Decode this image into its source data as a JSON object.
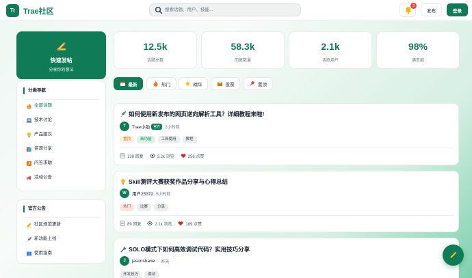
{
  "header": {
    "logo_badge": "Tr",
    "logo_text": "Trae社区",
    "search_placeholder": "搜索话题、用户、技能...",
    "notification_count": "3",
    "post_label": "发布",
    "login_label": "登录"
  },
  "sidebar": {
    "quick_post_title": "快速发帖",
    "quick_post_sub": "分享你的想法",
    "nav_title": "分类导航",
    "nav_items": [
      {
        "label": "全部话题",
        "icon": "fire-icon",
        "active": true
      },
      {
        "label": "技术讨论",
        "icon": "laptop-icon"
      },
      {
        "label": "产品建议",
        "icon": "lightbulb-icon"
      },
      {
        "label": "资源分享",
        "icon": "books-icon"
      },
      {
        "label": "问答求助",
        "icon": "question-icon"
      },
      {
        "label": "活动公告",
        "icon": "megaphone-icon"
      }
    ],
    "official_title": "官方公告",
    "official_items": [
      {
        "label": "社区规范更新",
        "icon": "pencil-icon"
      },
      {
        "label": "新功能上线",
        "icon": "rocket-icon"
      },
      {
        "label": "使用指南",
        "icon": "book-icon"
      }
    ]
  },
  "stats": [
    {
      "value": "12.5k",
      "label": "话题总数"
    },
    {
      "value": "58.3k",
      "label": "回复数量"
    },
    {
      "value": "2.1k",
      "label": "活跃用户"
    },
    {
      "value": "98%",
      "label": "满意度"
    }
  ],
  "tabs": [
    {
      "label": "最新",
      "icon": "calendar-icon",
      "active": true
    },
    {
      "label": "热门",
      "icon": "fire-icon"
    },
    {
      "label": "精华",
      "icon": "star-icon"
    },
    {
      "label": "投票",
      "icon": "ballot-icon"
    },
    {
      "label": "置顶",
      "icon": "pin-icon"
    }
  ],
  "posts": [
    {
      "icon": "rocket-icon",
      "title": "如何使用新发布的网页逆向解析工具？详细教程来啦!",
      "avatar": "T",
      "author": "Trae小助",
      "official_badge": "官方",
      "time": "2小时前",
      "tags": [
        "置顶",
        "新功能",
        "工具使用",
        "教程"
      ],
      "replies": "128 回复",
      "views": "3.2k 浏览",
      "likes": "256 点赞"
    },
    {
      "icon": "lightbulb-icon",
      "title": "Skill测评大赛获奖作品分享与心得总结",
      "avatar": "W",
      "author": "用户25372",
      "time": "5小时前",
      "tags": [
        "热门",
        "比赛",
        "分享"
      ],
      "replies": "89 回复",
      "views": "2.1k 浏览",
      "likes": "189 点赞"
    },
    {
      "icon": "wrench-icon",
      "title": "SOLO模式下如何高效调试代码？实用技巧分享",
      "avatar": "J",
      "author": "jasonshane",
      "time": "昨天",
      "tags": [
        "开发技巧",
        "调试"
      ]
    }
  ],
  "colors": {
    "accent": "#0f7b57",
    "badge": "#ef4444"
  }
}
